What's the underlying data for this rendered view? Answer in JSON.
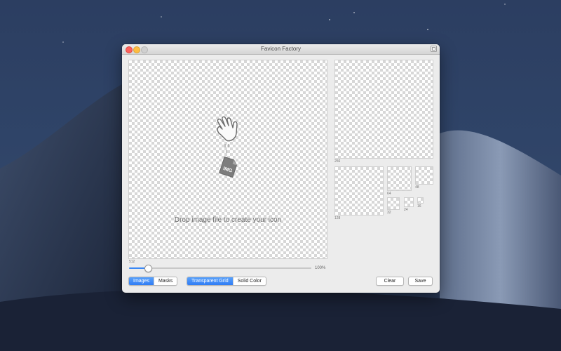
{
  "window": {
    "title": "Favicon Factory"
  },
  "canvas": {
    "drop_text": "Drop image file to create your icon",
    "size_label": "512",
    "file_badge": "IMG"
  },
  "slider": {
    "value_label": "100%",
    "value_fraction": 0.1
  },
  "previews": [
    {
      "size": "256"
    },
    {
      "size": "128"
    },
    {
      "size": "64"
    },
    {
      "size": "48"
    },
    {
      "size": "32"
    },
    {
      "size": "24"
    },
    {
      "size": "16"
    }
  ],
  "mode_segment": {
    "options": [
      "Images",
      "Masks"
    ],
    "selected": "Images"
  },
  "background_segment": {
    "options": [
      "Transparent Grid",
      "Solid Color"
    ],
    "selected": "Transparent Grid"
  },
  "buttons": {
    "clear": "Clear",
    "save": "Save"
  },
  "colors": {
    "accent": "#3b88f5",
    "close": "#fc605c",
    "minimize": "#fdbc40"
  },
  "icons": {
    "hand": "hand-drag-icon",
    "file": "image-file-icon",
    "fullscreen": "fullscreen-icon"
  }
}
